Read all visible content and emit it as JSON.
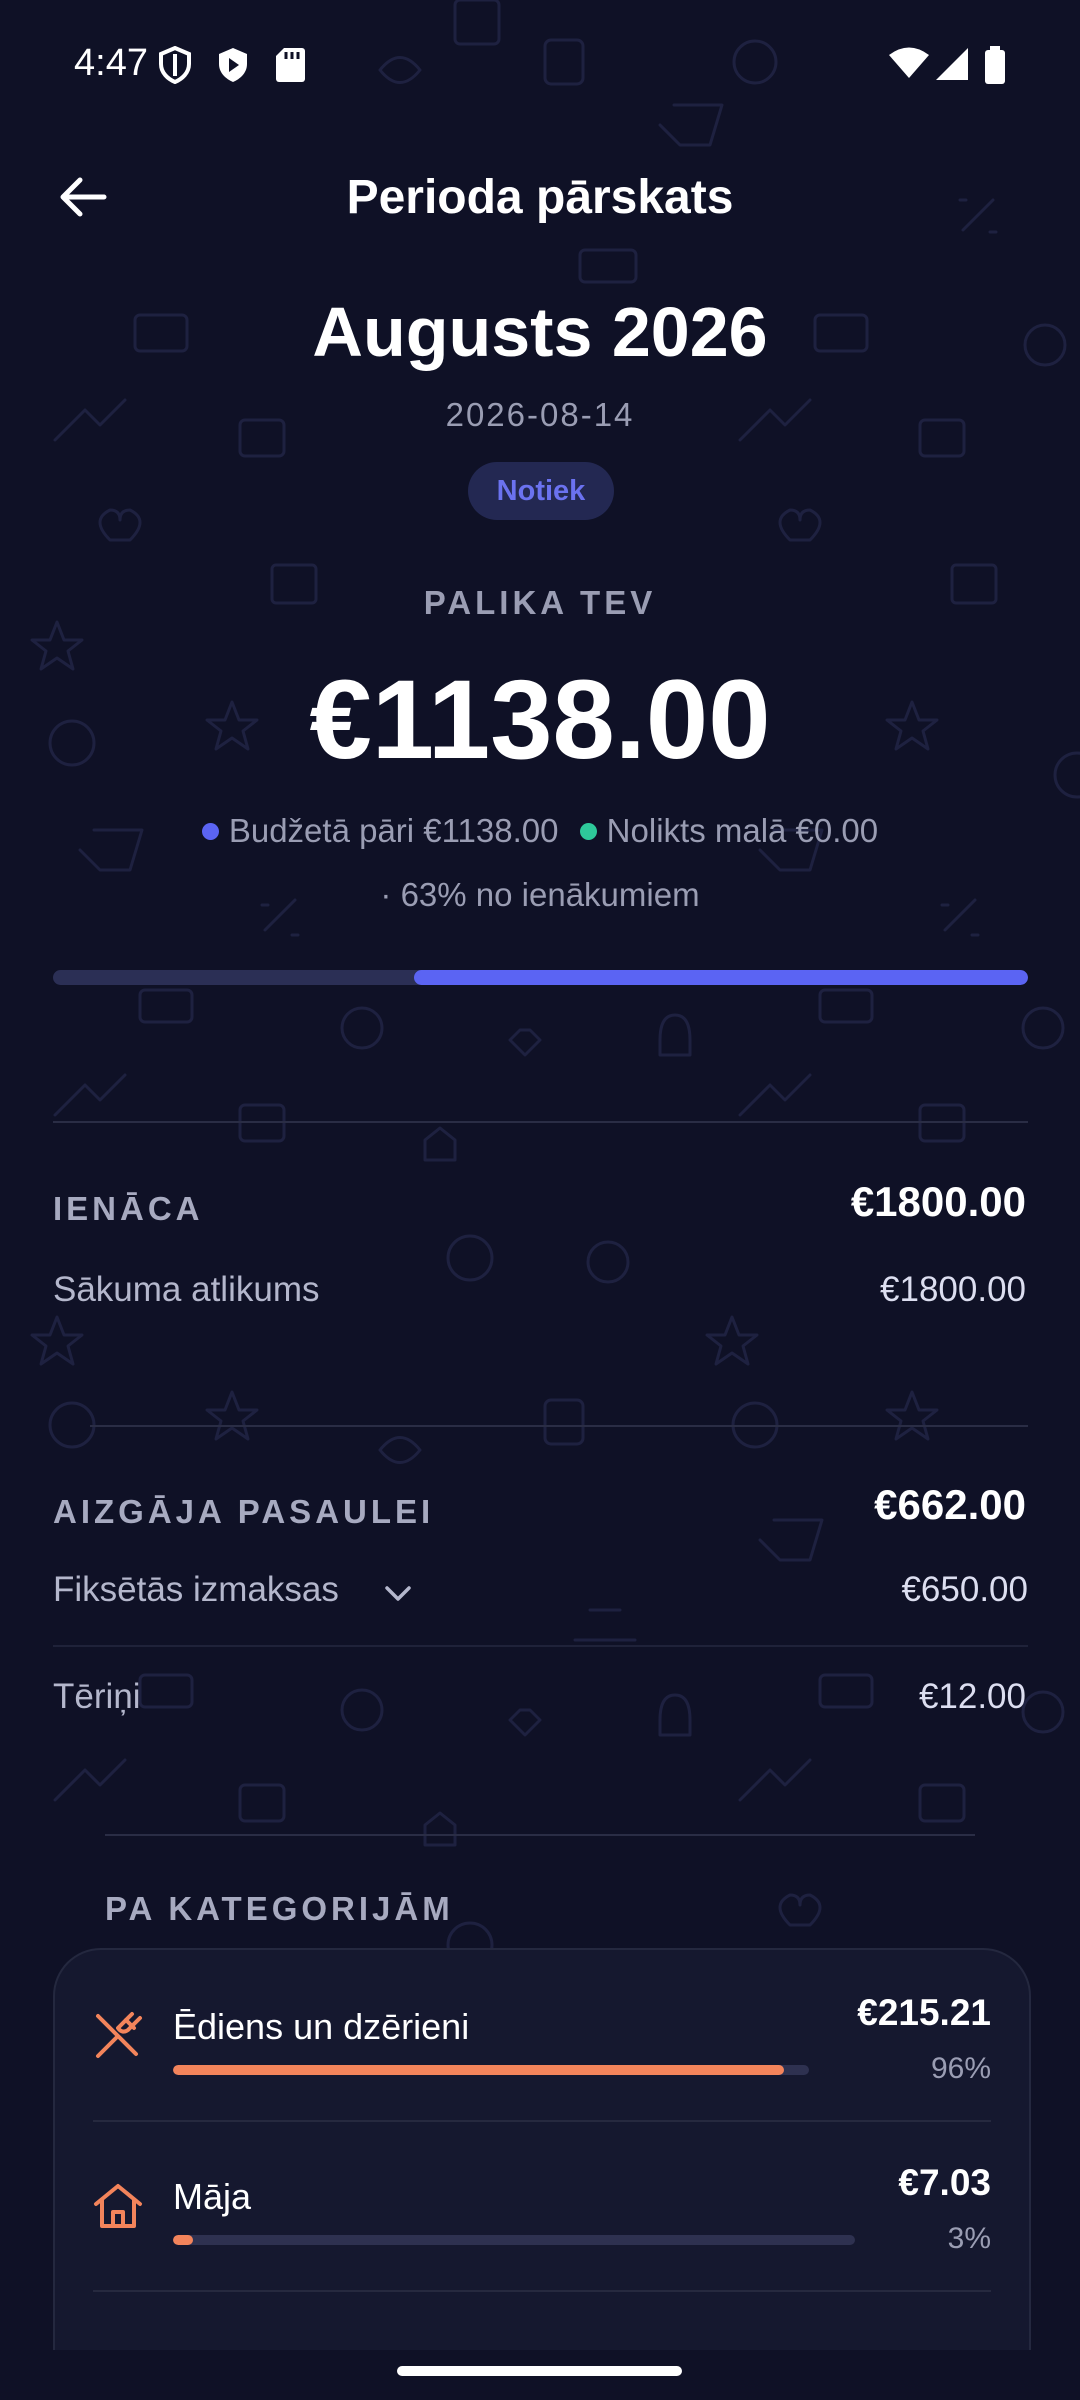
{
  "status_bar": {
    "time": "4:47"
  },
  "header": {
    "title": "Perioda pārskats"
  },
  "period": {
    "name": "Augusts 2026",
    "date": "2026-08-14",
    "status": "Notiek",
    "left_label": "PALIKA TEV",
    "left_amount": "€1138.00",
    "legend_budget": "Budžetā pāri €1138.00",
    "legend_saved": "Nolikts malā €0.00",
    "income_share": "· 63% no ienākumiem",
    "progress_fraction": 0.63,
    "colors": {
      "budget": "#5b64f3",
      "saved": "#2ec99a"
    }
  },
  "income": {
    "title": "IENĀCA",
    "total": "€1800.00",
    "rows": [
      {
        "label": "Sākuma atlikums",
        "value": "€1800.00"
      }
    ]
  },
  "spending": {
    "title": "AIZGĀJA PASAULEI",
    "total": "€662.00",
    "rows": [
      {
        "label": "Fiksētās izmaksas",
        "value": "€650.00"
      },
      {
        "label": "Tēriņi",
        "value": "€12.00"
      }
    ]
  },
  "categories": {
    "title": "PA KATEGORIJĀM",
    "items": [
      {
        "name": "Ēdiens un dzērieni",
        "amount": "€215.21",
        "percent": "96%",
        "fraction": 0.96,
        "icon": "fork-knife-icon",
        "color": "#f3845b"
      },
      {
        "name": "Māja",
        "amount": "€7.03",
        "percent": "3%",
        "fraction": 0.03,
        "icon": "home-icon",
        "color": "#f3845b"
      }
    ]
  }
}
